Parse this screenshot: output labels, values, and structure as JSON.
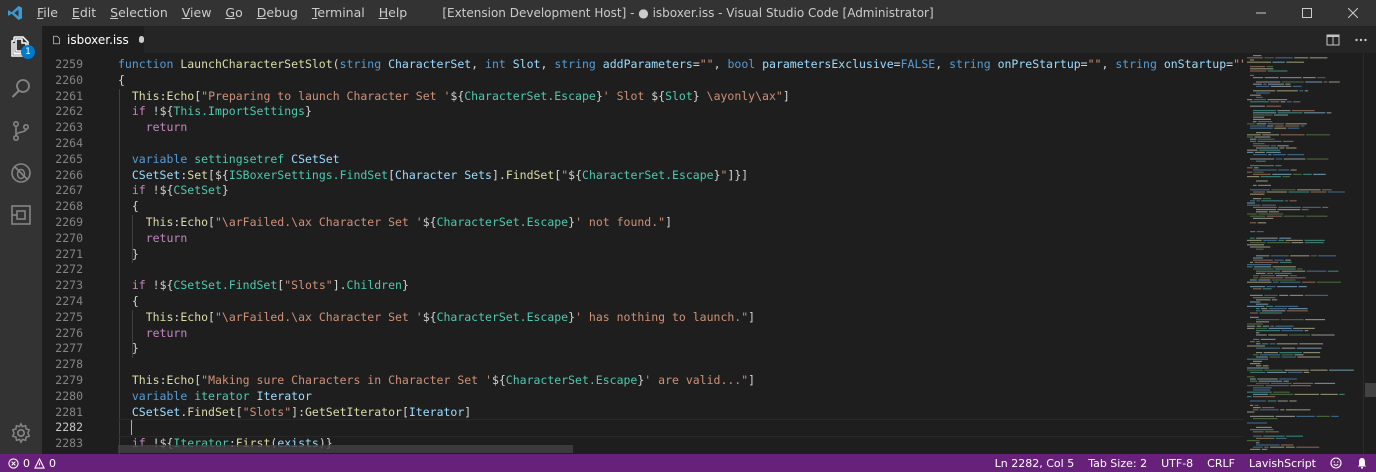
{
  "titlebar": {
    "menu": [
      "File",
      "Edit",
      "Selection",
      "View",
      "Go",
      "Debug",
      "Terminal",
      "Help"
    ],
    "menu_underline": [
      "F",
      "E",
      "S",
      "V",
      "G",
      "D",
      "T",
      "H"
    ],
    "window_title": "[Extension Development Host] - ● isboxer.iss - Visual Studio Code [Administrator]"
  },
  "activitybar": {
    "icons": [
      "explorer-icon",
      "search-icon",
      "source-control-icon",
      "debug-icon",
      "extensions-icon",
      "settings-gear-icon"
    ],
    "explorer_badge": "1"
  },
  "tab": {
    "label": "isboxer.iss"
  },
  "editor": {
    "line_numbers": [
      "2259",
      "2260",
      "2261",
      "2262",
      "2263",
      "2264",
      "2265",
      "2266",
      "2267",
      "2268",
      "2269",
      "2270",
      "2271",
      "2272",
      "2273",
      "2274",
      "2275",
      "2276",
      "2277",
      "2278",
      "2279",
      "2280",
      "2281",
      "2282",
      "2283"
    ],
    "current_line": "2282"
  },
  "status": {
    "errors": "0",
    "warnings": "0",
    "position": "Ln 2282, Col 5",
    "tab_size": "Tab Size: 2",
    "encoding": "UTF-8",
    "eol": "CRLF",
    "language": "LavishScript"
  },
  "colors": {
    "statusbar": "#68217a",
    "keyword": "#569cd6",
    "string": "#ce9178",
    "function": "#dcdcaa",
    "variable": "#9cdcfe",
    "type": "#4ec9b0"
  }
}
